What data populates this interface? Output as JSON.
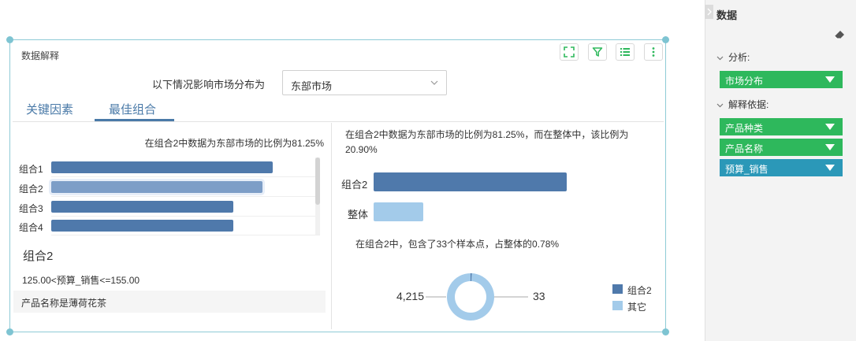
{
  "widget": {
    "title": "数据解释",
    "toolbar": {
      "fullscreen_icon": "fullscreen-icon",
      "filter_icon": "filter-icon",
      "list_icon": "list-icon",
      "more_icon": "more-vertical-icon"
    },
    "question_label": "以下情况影响市场分布为",
    "select_value": "东部市场",
    "tabs": [
      {
        "label": "关键因素",
        "active": false
      },
      {
        "label": "最佳组合",
        "active": true
      }
    ],
    "left": {
      "caption": "在组合2中数据为东部市场的比例为81.25%",
      "selected_title": "组合2",
      "conditions": [
        "125.00<预算_销售<=155.00",
        "产品名称是薄荷花茶"
      ]
    },
    "right": {
      "caption": "在组合2中数据为东部市场的比例为81.25%，而在整体中，该比例为20.90%",
      "sample_text": "在组合2中，包含了33个样本点，占整体的0.78%"
    }
  },
  "chart_data": [
    {
      "type": "bar",
      "orientation": "horizontal",
      "categories": [
        "组合1",
        "组合2",
        "组合3",
        "组合4"
      ],
      "values": [
        0.85,
        0.8125,
        0.7,
        0.7
      ],
      "selected": "组合2",
      "color": "#4f79ab",
      "selected_color": "#7d9ec7"
    },
    {
      "type": "bar",
      "orientation": "horizontal",
      "categories": [
        "组合2",
        "整体"
      ],
      "values": [
        0.8125,
        0.209
      ],
      "colors": [
        "#4f79ab",
        "#a3cbea"
      ]
    },
    {
      "type": "pie",
      "style": "donut",
      "labels": [
        "组合2",
        "其它"
      ],
      "values": [
        33,
        4215
      ],
      "value_labels": [
        "33",
        "4,215"
      ],
      "colors": [
        "#4f79ab",
        "#a3cbea"
      ],
      "legend": "right"
    }
  ],
  "panel": {
    "title": "数据",
    "toggle_icon": "chevron-right-icon",
    "clear_icon": "eraser-icon",
    "analysis_label": "分析:",
    "analysis_field": {
      "label": "市场分布",
      "color": "#2eb85c"
    },
    "basis_label": "解释依据:",
    "basis_fields": [
      {
        "label": "产品种类",
        "color": "#2eb85c"
      },
      {
        "label": "产品名称",
        "color": "#2eb85c"
      },
      {
        "label": "预算_销售",
        "color": "#2b98b8"
      }
    ]
  }
}
